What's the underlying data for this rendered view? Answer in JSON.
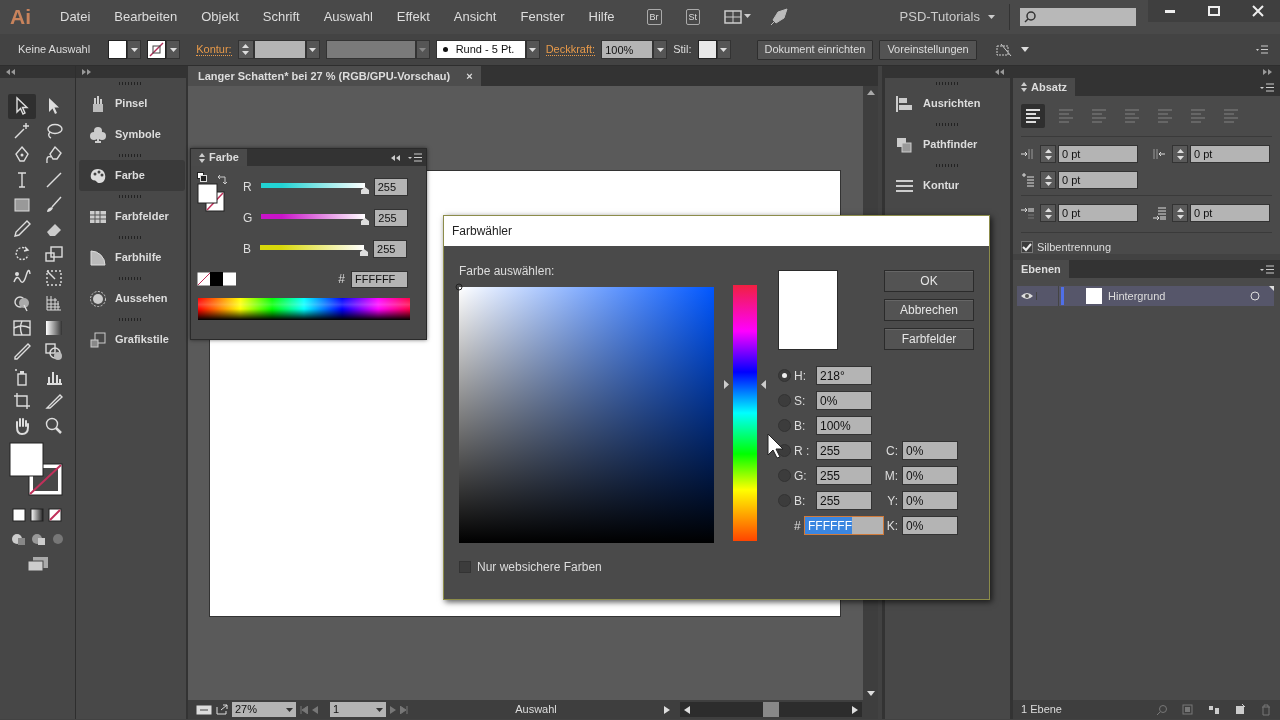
{
  "app": {
    "logo": "Ai",
    "menu": [
      "Datei",
      "Bearbeiten",
      "Objekt",
      "Schrift",
      "Auswahl",
      "Effekt",
      "Ansicht",
      "Fenster",
      "Hilfe"
    ],
    "bridge_button": "Br",
    "stock_button": "St",
    "workspace": "PSD-Tutorials"
  },
  "control_bar": {
    "selection": "Keine Auswahl",
    "stroke_label": "Kontur:",
    "brush": "Rund - 5 Pt.",
    "opacity_label": "Deckkraft:",
    "opacity": "100%",
    "style_label": "Stil:",
    "buttons": [
      "Dokument einrichten",
      "Voreinstellungen"
    ]
  },
  "tools": [
    {
      "selected": true
    },
    {
      "selected": false
    },
    {
      "selected": false
    },
    {
      "selected": false
    },
    {
      "selected": false
    },
    {
      "selected": false
    },
    {
      "selected": false
    },
    {
      "selected": false
    },
    {
      "selected": false
    },
    {
      "selected": false
    },
    {
      "selected": false
    },
    {
      "selected": false
    },
    {
      "selected": false
    },
    {
      "selected": false
    },
    {
      "selected": false
    },
    {
      "selected": false
    },
    {
      "selected": false
    },
    {
      "selected": false
    },
    {
      "selected": false
    },
    {
      "selected": false
    },
    {
      "selected": false
    },
    {
      "selected": false
    },
    {
      "selected": false
    },
    {
      "selected": false
    },
    {
      "selected": false
    },
    {
      "selected": false
    },
    {
      "selected": false
    },
    {
      "selected": false
    }
  ],
  "left_panels": [
    {
      "label": "Pinsel",
      "selected": false
    },
    {
      "label": "Symbole",
      "selected": false
    },
    {
      "label": "Farbe",
      "selected": true
    },
    {
      "label": "Farbfelder",
      "selected": false
    },
    {
      "label": "Farbhilfe",
      "selected": false
    },
    {
      "label": "Aussehen",
      "selected": false
    },
    {
      "label": "Grafikstile",
      "selected": false
    }
  ],
  "document": {
    "tab": "Langer Schatten* bei 27 % (RGB/GPU-Vorschau)",
    "close": "×"
  },
  "status_bar": {
    "zoom": "27%",
    "page": "1",
    "tool": "Auswahl"
  },
  "color_panel": {
    "title": "Farbe",
    "sliders": [
      {
        "label": "R",
        "level": 1,
        "value": "255",
        "color": "#22d3d3"
      },
      {
        "label": "G",
        "level": 1,
        "value": "255",
        "color": "#c814c8"
      },
      {
        "label": "B",
        "level": 1,
        "value": "255",
        "color": "#d8d80a"
      }
    ],
    "hex_label": "#",
    "hex": "FFFFFF"
  },
  "right_panels": [
    {
      "label": "Ausrichten"
    },
    {
      "label": "Pathfinder"
    },
    {
      "label": "Kontur"
    }
  ],
  "paragraph_panel": {
    "title": "Absatz",
    "alignments": [
      {
        "selected": true
      },
      {
        "selected": false
      },
      {
        "selected": false
      },
      {
        "selected": false
      },
      {
        "selected": false
      },
      {
        "selected": false
      },
      {
        "selected": false
      }
    ],
    "fields": [
      "0 pt",
      "0 pt",
      "0 pt",
      "0 pt",
      "0 pt"
    ],
    "hyphenation": {
      "label": "Silbentrennung",
      "checked": true
    }
  },
  "layers_panel": {
    "title": "Ebenen",
    "layers": [
      {
        "name": "Hintergrund",
        "visible": true,
        "selected": true,
        "color": "#4f6fe8"
      }
    ],
    "count": "1 Ebene"
  },
  "dialog": {
    "title": "Farbwähler",
    "prompt": "Farbe auswählen:",
    "hue": {
      "level": 0.61
    },
    "fields": [
      {
        "label": "H:",
        "value": "218°",
        "selected": true
      },
      {
        "label": "S:",
        "value": "0%",
        "selected": false
      },
      {
        "label": "B:",
        "value": "100%",
        "selected": false
      },
      {
        "label": "R :",
        "value": "255",
        "selected": false
      },
      {
        "label": "G:",
        "value": "255",
        "selected": false
      },
      {
        "label": "B:",
        "value": "255",
        "selected": false
      }
    ],
    "hex_label": "#",
    "hex": "FFFFFF",
    "cmyk": [
      {
        "label": "C:",
        "value": "0%"
      },
      {
        "label": "M:",
        "value": "0%"
      },
      {
        "label": "Y:",
        "value": "0%"
      },
      {
        "label": "K:",
        "value": "0%"
      }
    ],
    "buttons": [
      "OK",
      "Abbrechen",
      "Farbfelder"
    ],
    "websafe": {
      "label": "Nur websichere Farben",
      "checked": false
    }
  }
}
